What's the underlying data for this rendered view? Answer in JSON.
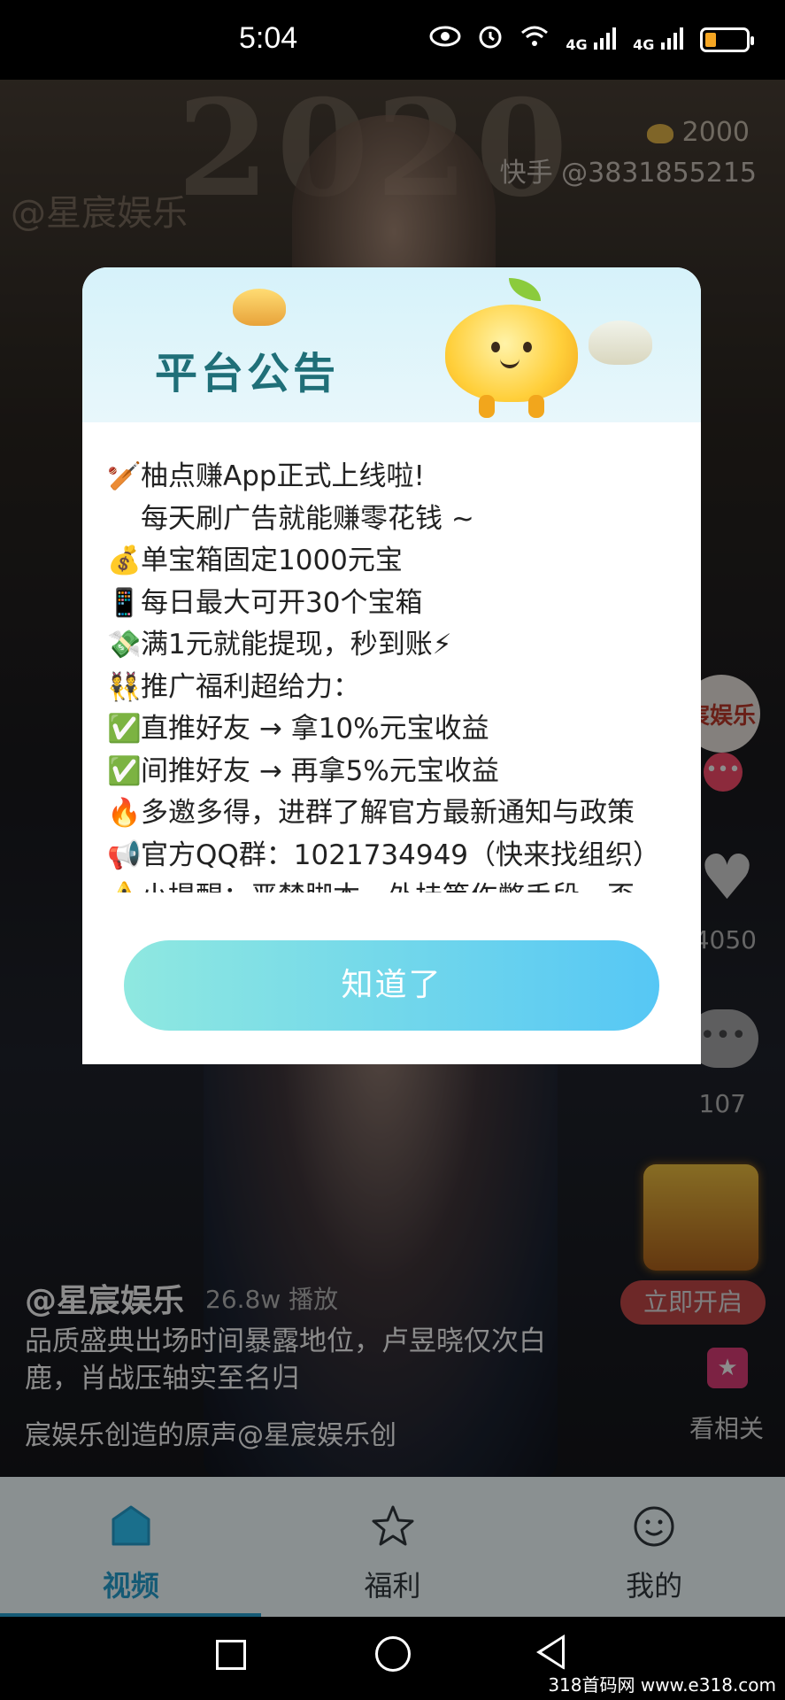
{
  "status_bar": {
    "time": "5:04",
    "icons": [
      "eye-icon",
      "alarm-icon",
      "wifi-6-icon",
      "signal-4g-icon",
      "signal-4g-icon",
      "battery-low-icon"
    ],
    "network_label_1": "4G",
    "network_label_2": "4G"
  },
  "video": {
    "coin_count": "2000",
    "kuaishou_id": "快手 @3831855215",
    "watermark": "@星宸娱乐",
    "avatar_text": "宸娱乐",
    "like_count": "4050",
    "comment_count": "107",
    "open_now": "立即开启",
    "related": "看相关",
    "author": "@星宸娱乐",
    "plays": "26.8w 播放",
    "description": "品质盛典出场时间暴露地位，卢昱晓仅次白鹿，肖战压轴实至名归",
    "music": "宸娱乐创造的原声@星宸娱乐创"
  },
  "dialog": {
    "title": "平台公告",
    "lines": [
      {
        "emoji": "🏏",
        "text": "柚点赚App正式上线啦!"
      },
      {
        "emoji": "",
        "text": "每天刷广告就能赚零花钱 ~"
      },
      {
        "emoji": "💰",
        "text": "单宝箱固定1000元宝"
      },
      {
        "emoji": "📱",
        "text": "每日最大可开30个宝箱"
      },
      {
        "emoji": "💸",
        "text": "满1元就能提现，秒到账⚡"
      },
      {
        "emoji": "👯",
        "text": "推广福利超给力："
      },
      {
        "emoji": "✅",
        "text": "直推好友 → 拿10%元宝收益"
      },
      {
        "emoji": "✅",
        "text": "间推好友 → 再拿5%元宝收益"
      },
      {
        "emoji": "🔥",
        "text": "多邀多得，进群了解官方最新通知与政策"
      },
      {
        "emoji": "📢",
        "text": "官方QQ群：1021734949（快来找组织）"
      },
      {
        "emoji": "⚠️",
        "text": "小提醒：严禁脚本、外挂等作弊手段，否"
      }
    ],
    "button": "知道了"
  },
  "bottom_nav": {
    "items": [
      {
        "label": "视频",
        "icon": "video-icon",
        "active": true
      },
      {
        "label": "福利",
        "icon": "star-icon",
        "active": false
      },
      {
        "label": "我的",
        "icon": "smiley-icon",
        "active": false
      }
    ],
    "active_color": "#155a75"
  },
  "site_watermark": "318首码网 www.e318.com"
}
